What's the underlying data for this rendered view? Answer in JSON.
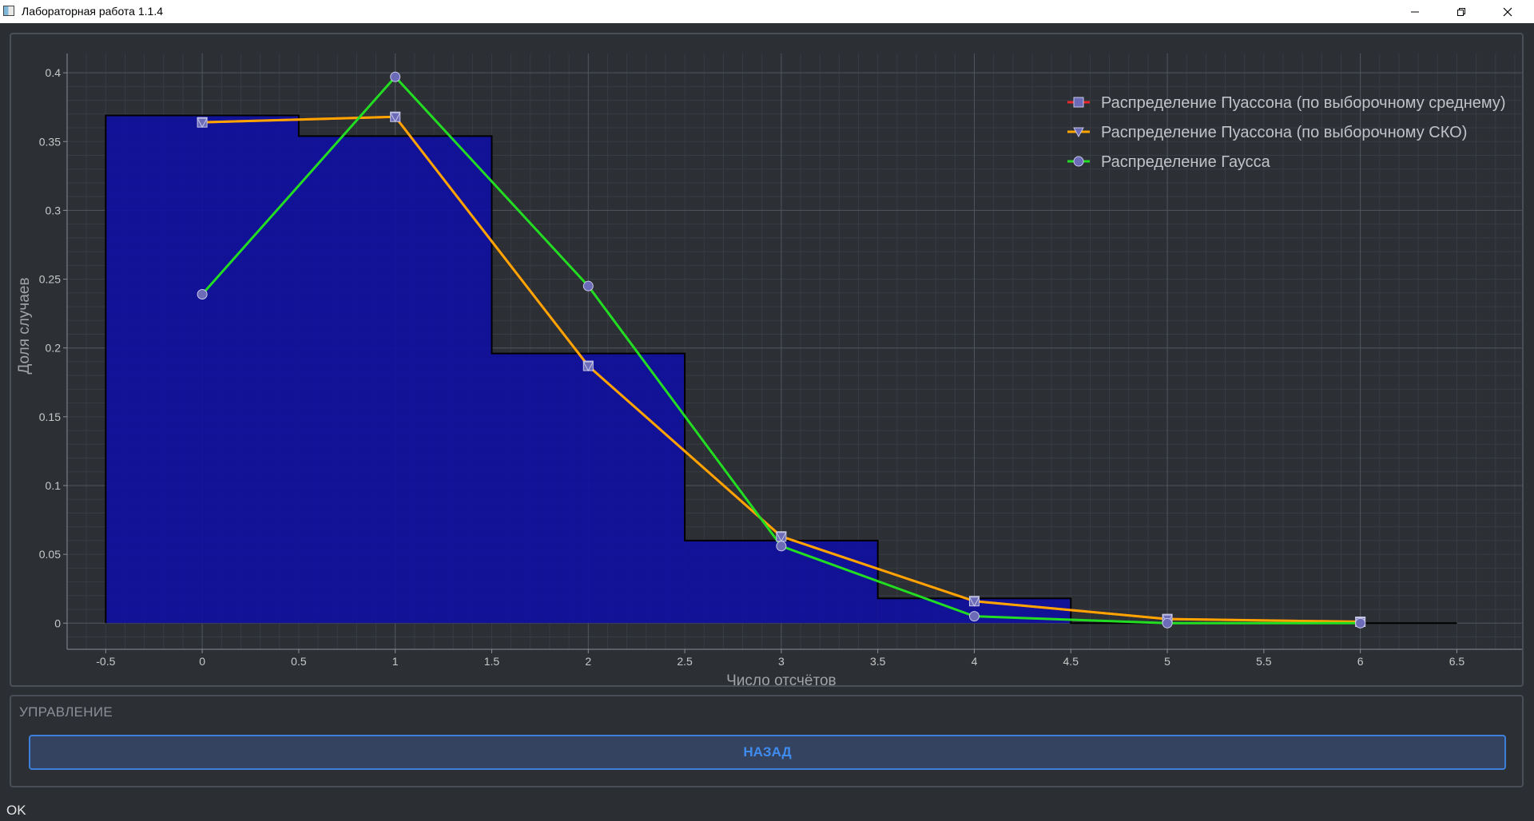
{
  "window": {
    "title": "Лабораторная работа 1.1.4",
    "icon": "app-window-icon"
  },
  "controls": {
    "group_title": "УПРАВЛЕНИЕ",
    "back_label": "НАЗАД"
  },
  "status": {
    "text": "OK"
  },
  "colors": {
    "background": "#2b2e33",
    "histogram_fill": "#1010a0",
    "poisson_mean": "#e8282a",
    "poisson_sko": "#ffa500",
    "gauss": "#22dd22",
    "marker": "#6b6bb8",
    "button_accent": "#3d7fd9"
  },
  "chart_data": {
    "type": "bar",
    "xlabel": "Число отсчётов",
    "ylabel": "Доля случаев",
    "xlim": [
      -0.7,
      6.85
    ],
    "ylim": [
      -0.019,
      0.414
    ],
    "grid": true,
    "legend_position": "top-right",
    "x_ticks": [
      "-0.5",
      "0",
      "0.5",
      "1",
      "1.5",
      "2",
      "2.5",
      "3",
      "3.5",
      "4",
      "4.5",
      "5",
      "5.5",
      "6",
      "6.5"
    ],
    "y_ticks": [
      "0",
      "0.05",
      "0.1",
      "0.15",
      "0.2",
      "0.25",
      "0.3",
      "0.35",
      "0.4"
    ],
    "histogram": {
      "bin_centers": [
        0,
        1,
        2,
        3,
        4,
        5,
        6
      ],
      "bin_width": 1,
      "values": [
        0.369,
        0.354,
        0.196,
        0.06,
        0.018,
        0.0,
        0.0
      ]
    },
    "series": [
      {
        "name": "Распределение Пуассона (по выборочному среднему)",
        "marker": "square",
        "x": [
          0,
          1,
          2,
          3,
          4,
          5,
          6
        ],
        "values": [
          0.364,
          0.368,
          0.187,
          0.063,
          0.016,
          0.003,
          0.001
        ]
      },
      {
        "name": "Распределение Пуассона (по выборочному СКО)",
        "marker": "triangle-down",
        "x": [
          0,
          1,
          2,
          3,
          4,
          5,
          6
        ],
        "values": [
          0.364,
          0.368,
          0.187,
          0.063,
          0.016,
          0.003,
          0.001
        ]
      },
      {
        "name": "Распределение Гаусса",
        "marker": "circle",
        "x": [
          0,
          1,
          2,
          3,
          4,
          5,
          6
        ],
        "values": [
          0.239,
          0.397,
          0.245,
          0.056,
          0.005,
          0.0,
          0.0
        ]
      }
    ]
  }
}
